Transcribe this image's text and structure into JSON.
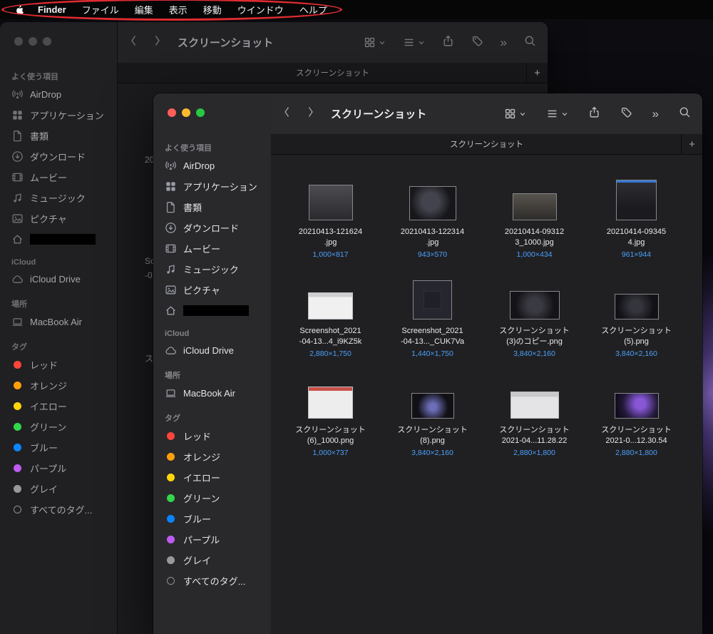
{
  "menu_bar": {
    "items": [
      {
        "label": "Finder",
        "bold": true
      },
      {
        "label": "ファイル"
      },
      {
        "label": "編集"
      },
      {
        "label": "表示"
      },
      {
        "label": "移動"
      },
      {
        "label": "ウインドウ"
      },
      {
        "label": "ヘルプ"
      }
    ]
  },
  "annotation": {
    "shape": "red-oval",
    "color": "#df2b2f",
    "target": "menu-bar"
  },
  "sidebar": {
    "favorites_label": "よく使う項目",
    "favorites": [
      {
        "label": "AirDrop",
        "icon": "airdrop-icon"
      },
      {
        "label": "アプリケーション",
        "icon": "applications-icon"
      },
      {
        "label": "書類",
        "icon": "documents-icon"
      },
      {
        "label": "ダウンロード",
        "icon": "downloads-icon"
      },
      {
        "label": "ムービー",
        "icon": "movies-icon"
      },
      {
        "label": "ミュージック",
        "icon": "music-icon"
      },
      {
        "label": "ピクチャ",
        "icon": "pictures-icon"
      },
      {
        "label": "",
        "icon": "home-icon",
        "redacted": true
      }
    ],
    "icloud_label": "iCloud",
    "icloud": [
      {
        "label": "iCloud Drive",
        "icon": "cloud-icon"
      }
    ],
    "locations_label": "場所",
    "locations": [
      {
        "label": "MacBook Air",
        "icon": "laptop-icon"
      }
    ],
    "tags_label": "タグ",
    "tags": [
      {
        "label": "レッド",
        "color": "#ff453a"
      },
      {
        "label": "オレンジ",
        "color": "#ff9f0a"
      },
      {
        "label": "イエロー",
        "color": "#ffd60a"
      },
      {
        "label": "グリーン",
        "color": "#32d74b"
      },
      {
        "label": "ブルー",
        "color": "#0a84ff"
      },
      {
        "label": "パープル",
        "color": "#bf5af2"
      },
      {
        "label": "グレイ",
        "color": "#98989d"
      }
    ],
    "all_tags_label": "すべてのタグ..."
  },
  "front_window": {
    "title": "スクリーンショット",
    "tab_title": "スクリーンショット",
    "new_tab_label": "+"
  },
  "back_window": {
    "title": "スクリーンショット",
    "tab_title": "スクリーンショット",
    "new_tab_label": "+",
    "partial_labels": [
      "20",
      "Sc",
      "-0",
      "ス"
    ]
  },
  "files": [
    {
      "name": "20210413-121624\n.jpg",
      "size": "1,000×817"
    },
    {
      "name": "20210413-122314\n.jpg",
      "size": "943×570"
    },
    {
      "name": "20210414-09312\n3_1000.jpg",
      "size": "1,000×434"
    },
    {
      "name": "20210414-09345\n4.jpg",
      "size": "961×944"
    },
    {
      "name": "Screenshot_2021\n-04-13...4_i9KZ5k",
      "size": "2,880×1,750"
    },
    {
      "name": "Screenshot_2021\n-04-13..._CUK7Va",
      "size": "1,440×1,750"
    },
    {
      "name": "スクリーンショット\n(3)のコピー.png",
      "size": "3,840×2,160"
    },
    {
      "name": "スクリーンショット\n(5).png",
      "size": "3,840×2,160"
    },
    {
      "name": "スクリーンショット\n(6)_1000.png",
      "size": "1,000×737"
    },
    {
      "name": "スクリーンショット\n(8).png",
      "size": "3,840×2,160"
    },
    {
      "name": "スクリーンショット\n2021-04...11.28.22",
      "size": "2,880×1,800"
    },
    {
      "name": "スクリーンショット\n2021-0...12.30.54",
      "size": "2,880×1,800"
    }
  ],
  "colors": {
    "file_size_text": "#4ba0fa",
    "menu_bar_bg": "#060607",
    "traffic_red": "#ff5f57",
    "traffic_yellow": "#febc2e",
    "traffic_green": "#28c840"
  },
  "icons": {
    "more_glyph": "»",
    "names": [
      "apple-icon",
      "back-icon",
      "forward-icon",
      "grid-view-icon",
      "chevron-down-icon",
      "group-icon",
      "share-icon",
      "tag-icon",
      "more-icon",
      "search-icon",
      "new-tab-icon",
      "airdrop-icon",
      "applications-icon",
      "documents-icon",
      "downloads-icon",
      "movies-icon",
      "music-icon",
      "pictures-icon",
      "home-icon",
      "cloud-icon",
      "laptop-icon",
      "tag-dot",
      "all-tags-icon"
    ]
  }
}
